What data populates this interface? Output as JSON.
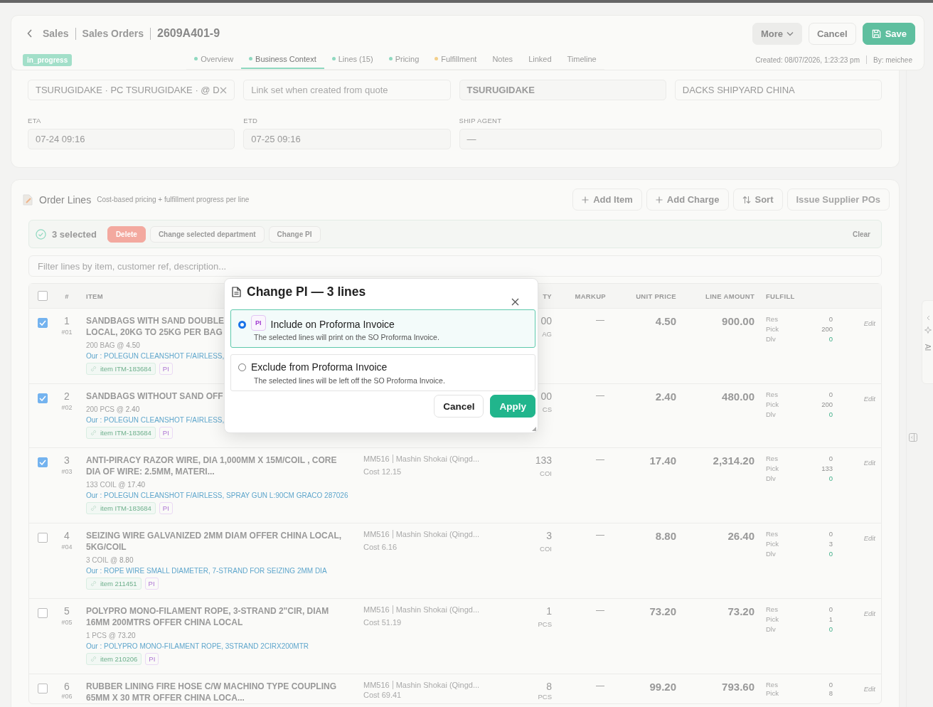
{
  "header": {
    "breadcrumbs": [
      "Sales",
      "Sales Orders"
    ],
    "title": "2609A401-9",
    "status": "in_progress",
    "actions": [
      {
        "label": "More",
        "kind": "menu"
      },
      {
        "label": "Cancel",
        "kind": "plain"
      },
      {
        "label": "Save",
        "kind": "primary"
      }
    ],
    "tabs": [
      {
        "label": "Overview",
        "selected": false,
        "color": "#8fd9c0"
      },
      {
        "label": "Business Context",
        "selected": true,
        "color": "#8fd9c0"
      },
      {
        "label": "Lines (15)",
        "selected": false,
        "color": "#8fd9c0"
      },
      {
        "label": "Pricing",
        "selected": false,
        "color": "#8fd9c0"
      },
      {
        "label": "Fulfillment",
        "selected": false,
        "color": "#f3cf8a"
      },
      {
        "label": "Notes",
        "selected": false
      },
      {
        "label": "Linked",
        "selected": false
      },
      {
        "label": "Timeline",
        "selected": false
      }
    ],
    "created": "Created: 08/07/2026, 1:23:23 pm",
    "by": "By: meichee"
  },
  "context_fields": [
    {
      "kind": "clearable",
      "value": "TSURUGIDAKE · PC TSURUGIDAKE · @ D"
    },
    {
      "kind": "text",
      "placeholder": "Link set when created from quote"
    },
    {
      "kind": "strong",
      "value": "TSURUGIDAKE"
    },
    {
      "kind": "text",
      "value": "DACKS SHIPYARD CHINA"
    }
  ],
  "schedule_fields": [
    {
      "kind": "normal",
      "label": "ETA",
      "value": "07-24 09:16"
    },
    {
      "kind": "normal",
      "label": "ETD",
      "value": "07-25 09:16"
    },
    {
      "kind": "wide",
      "label": "SHIP AGENT",
      "value": "—"
    }
  ],
  "order_lines": {
    "title": "Order Lines",
    "subtitle": "Cost-based pricing + fulfillment progress per line",
    "actions": [
      {
        "label": "Add Item",
        "kind": "add"
      },
      {
        "label": "Add Charge",
        "kind": "add"
      },
      {
        "label": "Sort",
        "kind": "sort"
      },
      {
        "label": "Issue Supplier POs",
        "kind": "disabled"
      }
    ],
    "bulk_bar": {
      "count": "3 selected",
      "actions": [
        {
          "label": "Delete",
          "kind": "danger"
        },
        {
          "label": "Change selected department",
          "kind": "plain"
        },
        {
          "label": "Change PI",
          "kind": "plain"
        }
      ],
      "clear": "Clear"
    },
    "filter": {
      "placeholder": "Filter lines by item, customer ref, description..."
    },
    "table": {
      "all_selected": false,
      "columns": [
        "#",
        "ITEM",
        "TY",
        "MARKUP",
        "UNIT PRICE",
        "LINE AMOUNT",
        "FULFILL"
      ],
      "rows": [
        {
          "selected": true,
          "num": "1",
          "ref": "#01",
          "name": "SANDBAGS WITH SAND DOUBLE LOCAL, 20KG TO 25KG PER BAG",
          "qty_line": "200 BAG @ **4.50**",
          "our": "Our : POLEGUN CLEANSHOT F/AIRLESS,",
          "item_tag": "item ITM-183684",
          "pi_tag": "PI",
          "qty": "00",
          "unit": "AG",
          "markup": "—",
          "unit_price": "4.50",
          "amount": "900.00",
          "fulfill": [
            {
              "kind": "res",
              "label": "Res",
              "value": "0"
            },
            {
              "kind": "pick",
              "label": "Pick",
              "value": "200"
            },
            {
              "kind": "dlv",
              "label": "Dlv",
              "value": "0"
            }
          ],
          "edit": "Edit"
        },
        {
          "selected": true,
          "num": "2",
          "ref": "#02",
          "name": "SANDBAGS WITHOUT SAND OFF",
          "qty_line": "200 PCS @ **2.40**",
          "our": "Our : POLEGUN CLEANSHOT F/AIRLESS,",
          "item_tag": "item ITM-183684",
          "pi_tag": "PI",
          "qty": "00",
          "unit": "CS",
          "markup": "—",
          "unit_price": "2.40",
          "amount": "480.00",
          "fulfill": [
            {
              "kind": "res",
              "label": "Res",
              "value": "0"
            },
            {
              "kind": "pick",
              "label": "Pick",
              "value": "200"
            },
            {
              "kind": "dlv",
              "label": "Dlv",
              "value": "0"
            }
          ],
          "edit": "Edit"
        },
        {
          "selected": true,
          "num": "3",
          "ref": "#03",
          "name": "ANTI-PIRACY RAZOR WIRE, DIA 1,000MM X 15M/COIL , CORE DIA OF WIRE: 2.5MM, MATERI...",
          "qty_line": "133 COIL @ **17.40**",
          "our": "Our : POLEGUN CLEANSHOT F/AIRLESS, SPRAY GUN L:90CM GRACO 287026",
          "item_tag": "item ITM-183684",
          "pi_tag": "PI",
          "supplier_code": "MM516",
          "supplier": "Mashin Shokai (Qingd...",
          "cost": "Cost 12.15",
          "qty": "133",
          "unit": "COI",
          "markup": "—",
          "unit_price": "17.40",
          "amount": "2,314.20",
          "fulfill": [
            {
              "kind": "res",
              "label": "Res",
              "value": "0"
            },
            {
              "kind": "pick",
              "label": "Pick",
              "value": "133"
            },
            {
              "kind": "dlv",
              "label": "Dlv",
              "value": "0"
            }
          ],
          "edit": "Edit"
        },
        {
          "selected": false,
          "num": "4",
          "ref": "#04",
          "name": "SEIZING WIRE GALVANIZED 2MM DIAM OFFER CHINA LOCAL, 5KG/COIL",
          "qty_line": "3 COIL @ **8.80**",
          "our": "Our : ROPE WIRE SMALL DIAMETER, 7-STRAND FOR SEIZING 2MM DIA",
          "item_tag": "item 211451",
          "pi_tag": "PI",
          "supplier_code": "MM516",
          "supplier": "Mashin Shokai (Qingd...",
          "cost": "Cost 6.16",
          "qty": "3",
          "unit": "COI",
          "markup": "—",
          "unit_price": "8.80",
          "amount": "26.40",
          "fulfill": [
            {
              "kind": "res",
              "label": "Res",
              "value": "0"
            },
            {
              "kind": "pick",
              "label": "Pick",
              "value": "3"
            },
            {
              "kind": "dlv",
              "label": "Dlv",
              "value": "0"
            }
          ],
          "edit": "Edit"
        },
        {
          "selected": false,
          "num": "5",
          "ref": "#05",
          "name": "POLYPRO MONO-FILAMENT ROPE, 3-STRAND 2\"CIR, DIAM 16MM 200MTRS OFFER CHINA LOCAL",
          "qty_line": "1 PCS @ **73.20**",
          "our": "Our : POLYPRO MONO-FILAMENT ROPE, 3STRAND 2CIRX200MTR",
          "item_tag": "item 210206",
          "pi_tag": "PI",
          "supplier_code": "MM516",
          "supplier": "Mashin Shokai (Qingd...",
          "cost": "Cost 51.19",
          "qty": "1",
          "unit": "PCS",
          "markup": "—",
          "unit_price": "73.20",
          "amount": "73.20",
          "fulfill": [
            {
              "kind": "res",
              "label": "Res",
              "value": "0"
            },
            {
              "kind": "pick",
              "label": "Pick",
              "value": "1"
            },
            {
              "kind": "dlv",
              "label": "Dlv",
              "value": "0"
            }
          ],
          "edit": "Edit"
        },
        {
          "selected": false,
          "num": "6",
          "ref": "#06",
          "name": "RUBBER LINING FIRE HOSE C/W MACHINO TYPE COUPLING 65MM X 30 MTR OFFER CHINA LOCA...",
          "supplier_code": "MM516",
          "supplier": "Mashin Shokai (Qingd...",
          "cost": "Cost 69.41",
          "qty": "8",
          "unit": "PCS",
          "markup": "—",
          "unit_price": "99.20",
          "amount": "793.60",
          "fulfill": [
            {
              "kind": "res",
              "label": "Res",
              "value": "0"
            },
            {
              "kind": "pick",
              "label": "Pick",
              "value": "8"
            }
          ],
          "edit": "Edit"
        }
      ]
    }
  },
  "modal": {
    "title": "Change PI — 3 lines",
    "options": [
      {
        "badge": "PI",
        "label": "Include on Proforma Invoice",
        "description": "The selected lines will print on the SO Proforma Invoice.",
        "selected": true
      },
      {
        "label": "Exclude from Proforma Invoice",
        "description": "The selected lines will be left off the SO Proforma Invoice.",
        "selected": false
      }
    ],
    "buttons": [
      {
        "label": "Cancel",
        "kind": "secondary"
      },
      {
        "label": "Apply",
        "kind": "primary"
      }
    ]
  },
  "ai_tab": {
    "label": "AI"
  }
}
